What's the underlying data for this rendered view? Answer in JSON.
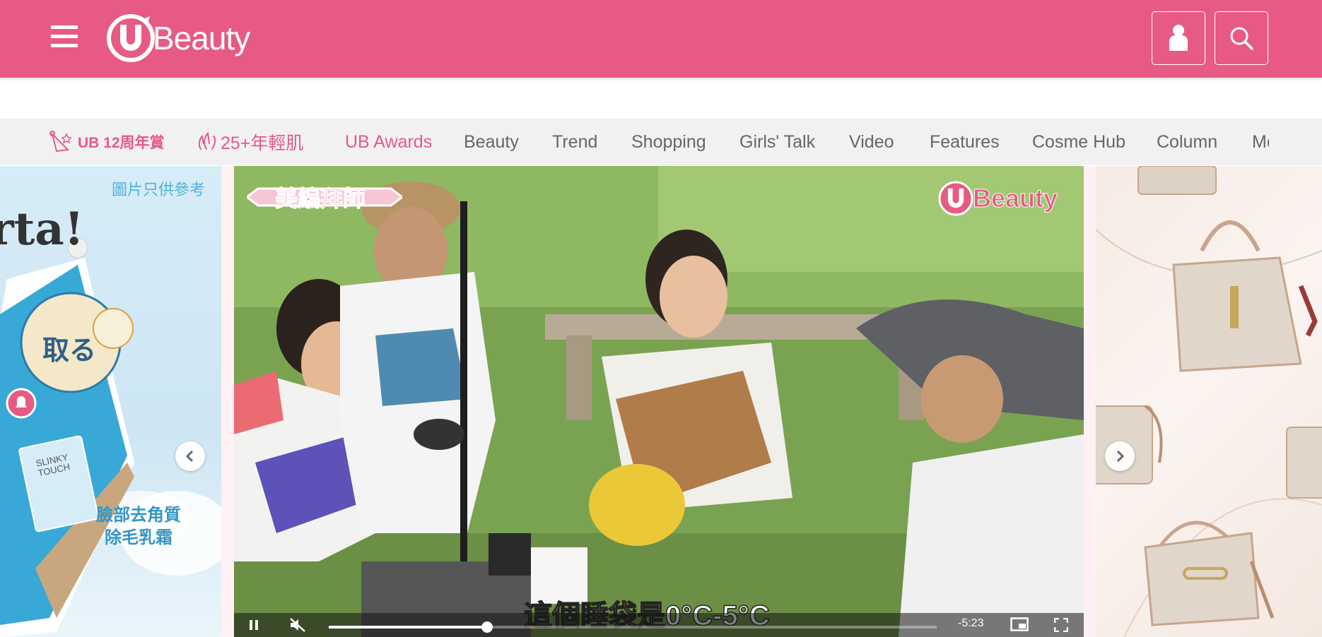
{
  "header": {
    "logo_text": "Beauty",
    "menu_icon": "hamburger-menu-icon",
    "account_icon": "user-icon",
    "search_icon": "search-icon",
    "bg_color": "#e75a83"
  },
  "nav": {
    "items": [
      {
        "label": "UB 12周年賞"
      },
      {
        "label": "25+年輕肌"
      },
      {
        "label": "UB Awards"
      },
      {
        "label": "Beauty"
      },
      {
        "label": "Trend"
      },
      {
        "label": "Shopping"
      },
      {
        "label": "Girls' Talk"
      },
      {
        "label": "Video"
      },
      {
        "label": "Features"
      },
      {
        "label": "Cosme Hub"
      },
      {
        "label": "Column"
      },
      {
        "label": "Mo"
      }
    ]
  },
  "left_ad": {
    "disclaimer": "圖片只供參考",
    "headline": "rta!",
    "product_line1": "臉部去角質",
    "product_line2": "除毛乳霜",
    "tube_brand": "SLINKY TOUCH",
    "tube_label": "取る"
  },
  "video": {
    "badge": "美編拜師",
    "watermark": "Beauty",
    "subtitle": "這個睡袋是0°C-5°C",
    "time_remaining": "-5:23",
    "progress": 0.26
  },
  "colors": {
    "accent": "#e75a83",
    "nav_bg": "#f1f1f1",
    "nav_text": "#666666"
  }
}
